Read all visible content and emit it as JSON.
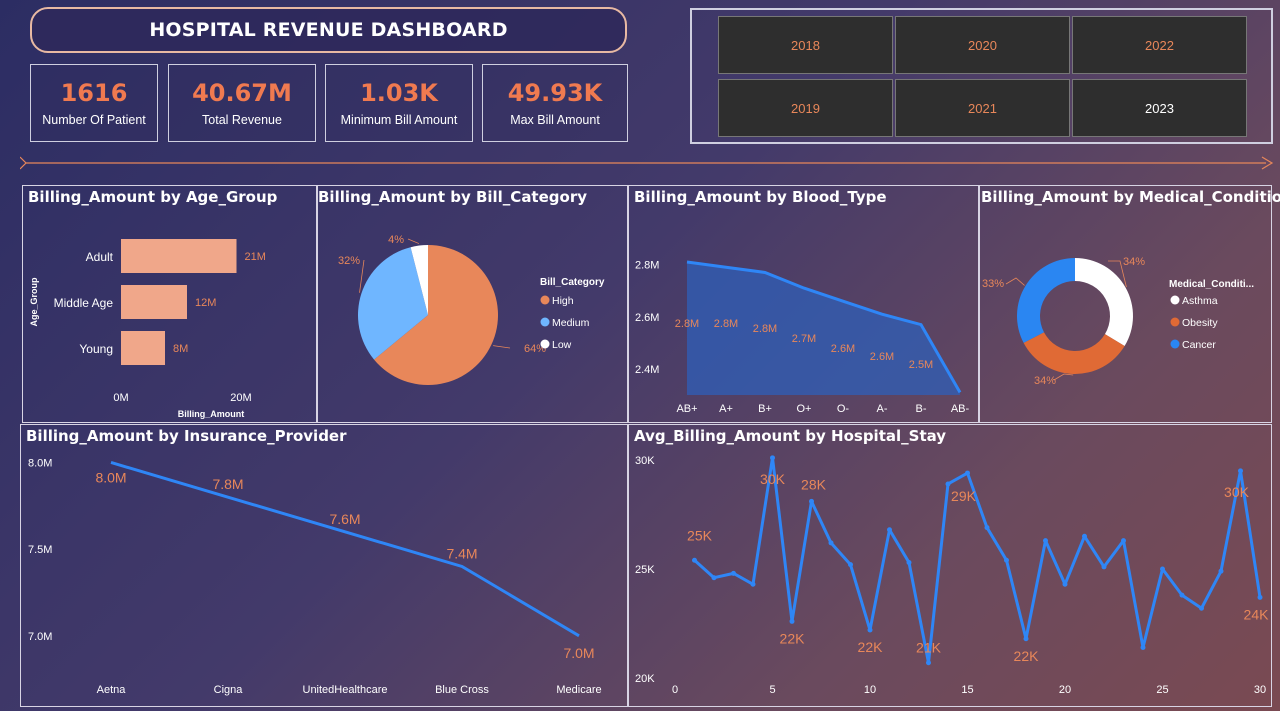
{
  "header": {
    "title": "HOSPITAL REVENUE DASHBOARD"
  },
  "kpis": [
    {
      "value": "1616",
      "label": "Number Of Patient"
    },
    {
      "value": "40.67M",
      "label": "Total Revenue"
    },
    {
      "value": "1.03K",
      "label": "Minimum Bill Amount"
    },
    {
      "value": "49.93K",
      "label": "Max Bill Amount"
    }
  ],
  "year_slicer": {
    "years": [
      "2018",
      "2020",
      "2022",
      "2019",
      "2021",
      "2023"
    ],
    "selected": "2023"
  },
  "colors": {
    "orange": "#e8875a",
    "blue": "#2f86f6",
    "light_blue": "#6fb6ff",
    "salmon": "#f0a78a",
    "white": "#ffffff"
  },
  "panels": {
    "age": {
      "title": "Billing_Amount by Age_Group"
    },
    "bill": {
      "title": "Billing_Amount by Bill_Category"
    },
    "blood": {
      "title": "Billing_Amount by Blood_Type"
    },
    "medical": {
      "title": "Billing_Amount by Medical_Condition"
    },
    "insurance": {
      "title": "Billing_Amount by Insurance_Provider"
    },
    "stay": {
      "title": "Avg_Billing_Amount by Hospital_Stay"
    }
  },
  "chart_data": [
    {
      "id": "age",
      "type": "bar",
      "orientation": "horizontal",
      "categories": [
        "Adult",
        "Middle Age",
        "Young"
      ],
      "values": [
        21,
        12,
        8
      ],
      "data_labels": [
        "21M",
        "12M",
        "8M"
      ],
      "xlabel": "Billing_Amount",
      "ylabel": "Age_Group",
      "x_ticks": [
        "0M",
        "20M"
      ],
      "xlim": [
        0,
        24
      ]
    },
    {
      "id": "bill",
      "type": "pie",
      "legend_title": "Bill_Category",
      "legend_position": "right",
      "categories": [
        "High",
        "Medium",
        "Low"
      ],
      "values": [
        64,
        32,
        4
      ],
      "data_labels": [
        "64%",
        "32%",
        "4%"
      ]
    },
    {
      "id": "blood",
      "type": "area",
      "categories": [
        "AB+",
        "A+",
        "B+",
        "O+",
        "O-",
        "A-",
        "B-",
        "AB-"
      ],
      "values": [
        2.81,
        2.79,
        2.77,
        2.71,
        2.66,
        2.61,
        2.57,
        2.31
      ],
      "data_labels": [
        "2.8M",
        "2.8M",
        "2.8M",
        "2.7M",
        "2.6M",
        "2.6M",
        "2.5M",
        ""
      ],
      "y_ticks": [
        "2.8M",
        "2.6M",
        "2.4M"
      ],
      "ylim": [
        2.3,
        2.86
      ]
    },
    {
      "id": "medical",
      "type": "pie",
      "variant": "donut",
      "legend_title": "Medical_Conditi...",
      "legend_position": "right",
      "categories": [
        "Asthma",
        "Obesity",
        "Cancer"
      ],
      "values": [
        34,
        34,
        33
      ],
      "data_labels": [
        "34%",
        "34%",
        "33%"
      ]
    },
    {
      "id": "insurance",
      "type": "line",
      "categories": [
        "Aetna",
        "Cigna",
        "UnitedHealthcare",
        "Blue Cross",
        "Medicare"
      ],
      "values": [
        8.0,
        7.8,
        7.6,
        7.4,
        7.0
      ],
      "data_labels": [
        "8.0M",
        "7.8M",
        "7.6M",
        "7.4M",
        "7.0M"
      ],
      "y_ticks": [
        "8.0M",
        "7.5M",
        "7.0M"
      ],
      "ylim": [
        6.97,
        8.02
      ]
    },
    {
      "id": "stay",
      "type": "line",
      "x": [
        1,
        2,
        3,
        4,
        5,
        6,
        7,
        8,
        9,
        10,
        11,
        12,
        13,
        14,
        15,
        16,
        17,
        18,
        19,
        20,
        21,
        22,
        23,
        24,
        25,
        26,
        27,
        28,
        29,
        30
      ],
      "values": [
        25.4,
        24.6,
        24.8,
        24.3,
        30.1,
        22.6,
        28.1,
        26.2,
        25.2,
        22.2,
        26.8,
        25.3,
        20.7,
        28.9,
        29.4,
        26.9,
        25.4,
        21.8,
        26.3,
        24.3,
        26.5,
        25.1,
        26.3,
        21.4,
        25,
        23.8,
        23.2,
        24.9,
        29.5,
        23.7
      ],
      "data_labels": [
        {
          "x": 1,
          "label": "25K"
        },
        {
          "x": 5,
          "label": "30K"
        },
        {
          "x": 6,
          "label": "22K"
        },
        {
          "x": 7,
          "label": "28K"
        },
        {
          "x": 10,
          "label": "22K"
        },
        {
          "x": 13,
          "label": "21K"
        },
        {
          "x": 15,
          "label": "29K"
        },
        {
          "x": 18,
          "label": "22K"
        },
        {
          "x": 29,
          "label": "30K"
        },
        {
          "x": 30,
          "label": "24K"
        }
      ],
      "y_ticks": [
        "30K",
        "25K",
        "20K"
      ],
      "x_ticks": [
        "0",
        "5",
        "10",
        "15",
        "20",
        "25",
        "30"
      ],
      "ylim": [
        20,
        30
      ],
      "xlim": [
        0,
        30
      ]
    }
  ]
}
